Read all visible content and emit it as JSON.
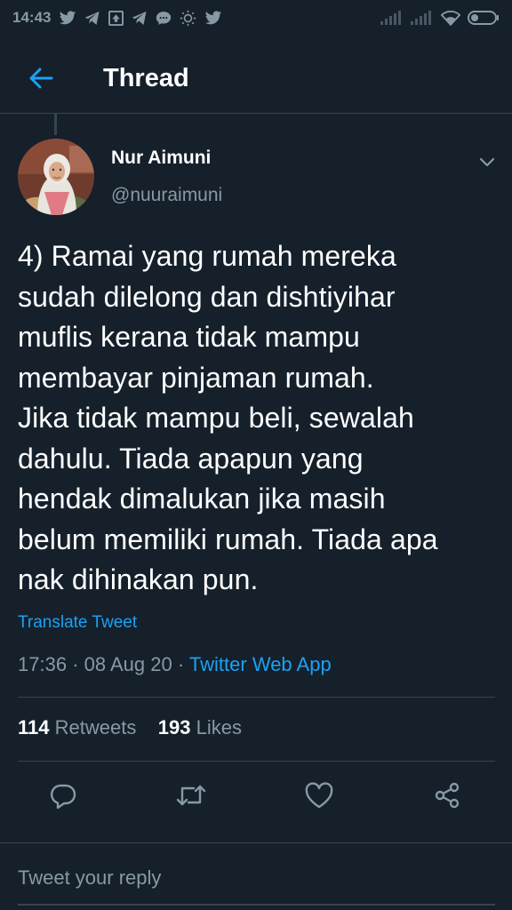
{
  "status_bar": {
    "time": "14:43"
  },
  "header": {
    "title": "Thread"
  },
  "tweet": {
    "author_name": "Nur Aimuni",
    "author_handle": "@nuuraimuni",
    "text": "4) Ramai yang rumah mereka\nsudah dilelong dan dishtiyihar\nmuflis kerana tidak mampu\nmembayar pinjaman rumah.\nJika tidak mampu beli, sewalah\ndahulu. Tiada apapun yang\nhendak dimalukan jika masih\nbelum memiliki rumah. Tiada apa\nnak dihinakan pun.",
    "translate_label": "Translate Tweet",
    "time": "17:36",
    "date": "08 Aug 20",
    "separator": "·",
    "source": "Twitter Web App"
  },
  "stats": {
    "retweets_count": "114",
    "retweets_label": "Retweets",
    "likes_count": "193",
    "likes_label": "Likes"
  },
  "reply": {
    "placeholder": "Tweet your reply"
  },
  "colors": {
    "background": "#15202b",
    "accent": "#1da1f2",
    "secondary_text": "#8899a6",
    "divider": "#38444d"
  },
  "icons": {
    "back": "back-arrow-icon",
    "more": "chevron-down-icon",
    "reply": "reply-icon",
    "retweet": "retweet-icon",
    "like": "heart-icon",
    "share": "share-icon"
  }
}
